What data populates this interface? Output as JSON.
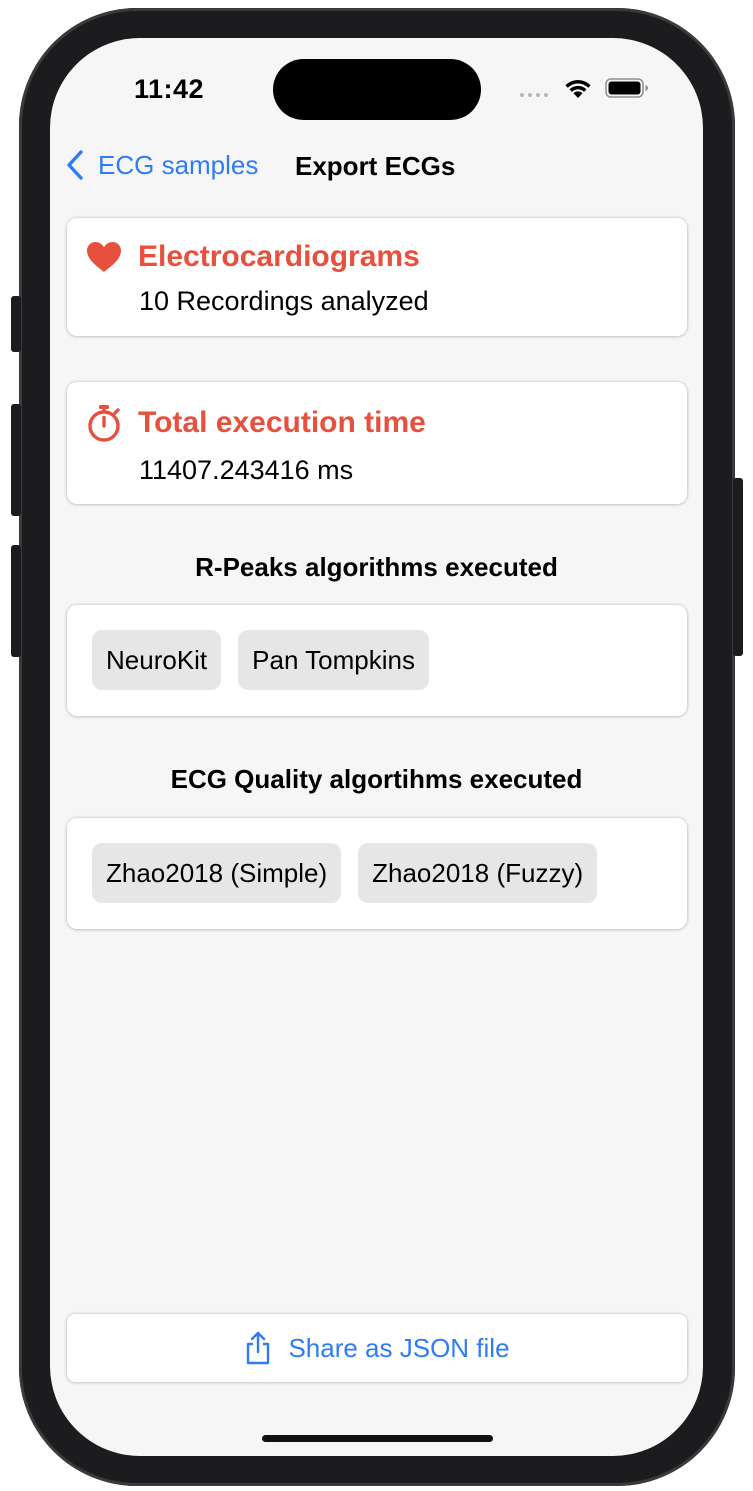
{
  "status_bar": {
    "time": "11:42"
  },
  "nav": {
    "back_label": "ECG samples",
    "title": "Export ECGs"
  },
  "ecg_card": {
    "icon": "heart-icon",
    "title": "Electrocardiograms",
    "subtitle": "10 Recordings analyzed"
  },
  "time_card": {
    "icon": "stopwatch-icon",
    "title": "Total execution time",
    "subtitle": "11407.243416 ms"
  },
  "rpeaks": {
    "section_title": "R-Peaks algorithms executed",
    "items": [
      "NeuroKit",
      "Pan Tompkins"
    ]
  },
  "quality": {
    "section_title": "ECG Quality algortihms executed",
    "items": [
      "Zhao2018 (Simple)",
      "Zhao2018 (Fuzzy)"
    ]
  },
  "share": {
    "icon": "share-icon",
    "label": "Share as JSON file"
  },
  "colors": {
    "accent": "#2f7cf6",
    "highlight": "#e8503e",
    "background": "#f6f6f6",
    "chip": "#e6e6e6"
  }
}
